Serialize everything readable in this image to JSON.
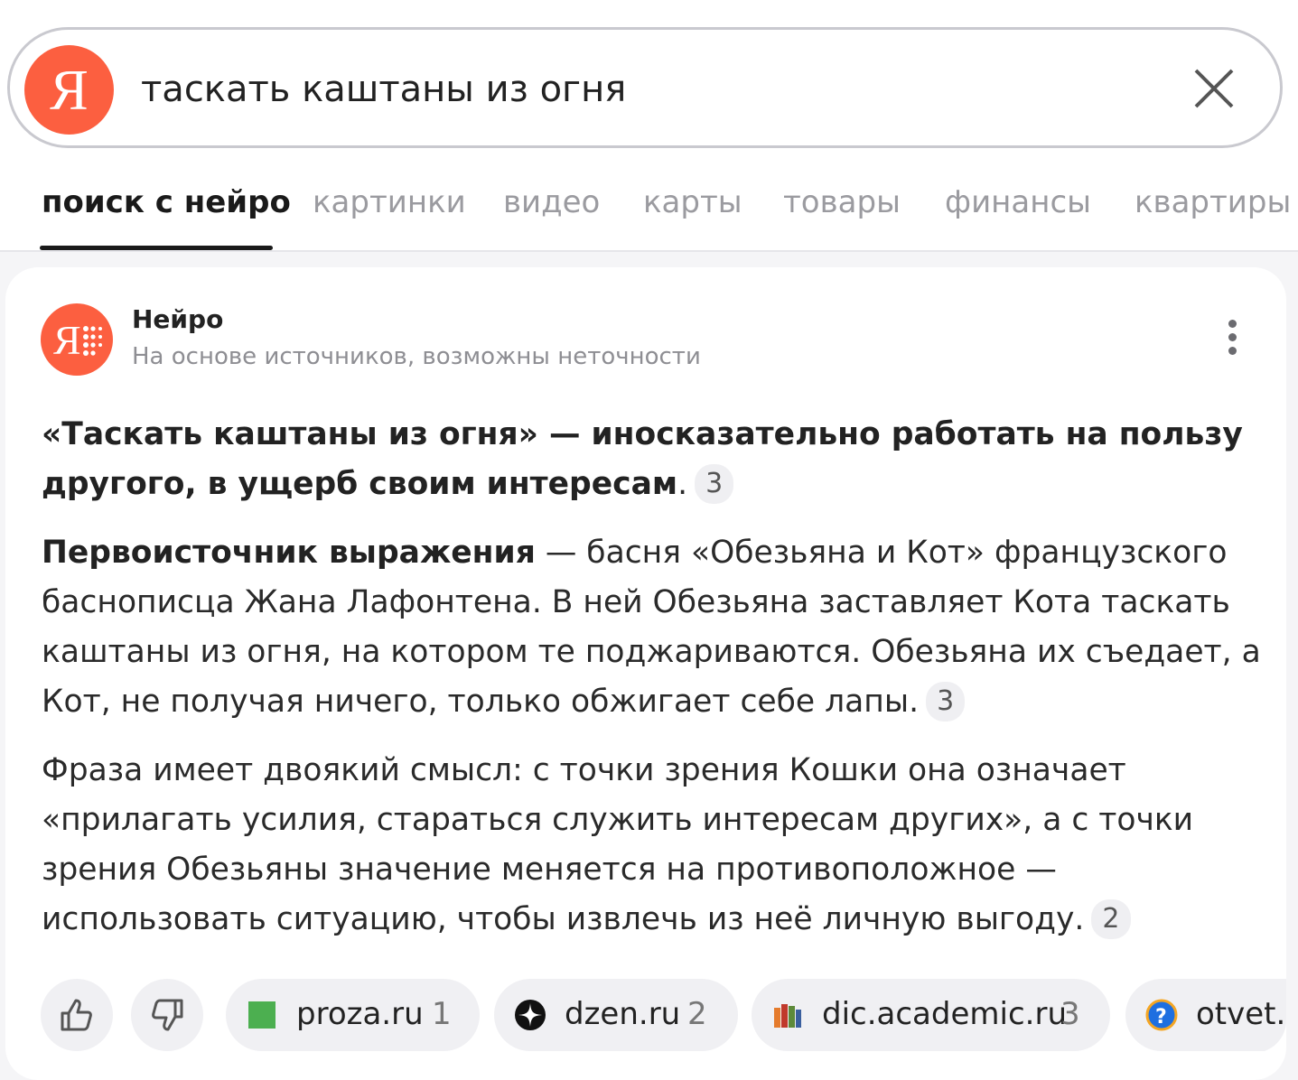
{
  "search": {
    "logo_letter": "Я",
    "query": "таскать каштаны из огня"
  },
  "tabs": [
    {
      "label": "поиск с нейро",
      "active": true
    },
    {
      "label": "картинки"
    },
    {
      "label": "видео"
    },
    {
      "label": "карты"
    },
    {
      "label": "товары"
    },
    {
      "label": "финансы"
    },
    {
      "label": "квартиры"
    }
  ],
  "answer": {
    "source_name": "Нейро",
    "disclaimer": "На основе источников, возможны неточности",
    "p1_bold": "«Таскать каштаны из огня» — иносказательно работать на пользу другого, в ущерб своим интересам",
    "p1_end": ".",
    "p1_cite": "3",
    "p2_bold": "Первоисточник выражения",
    "p2_text": " — басня «Обезьяна и Кот» французского баснописца Жана Лафонтена. В ней Обезьяна заставляет Кота таскать каштаны из огня, на котором те поджариваются. Обезьяна их съедает, а Кот, не получая ничего, только обжигает себе лапы.",
    "p2_cite": "3",
    "p3_text": "Фраза имеет двоякий смысл: с точки зрения Кошки она означает «прилагать усилия, стараться служить интересам других», а с точки зрения Обезьяны значение меняется на противоположное — использовать ситуацию, чтобы извлечь из неё личную выгоду.",
    "p3_cite": "2"
  },
  "sources": [
    {
      "site": "proza.ru",
      "num": "1",
      "icon": "green-square-icon"
    },
    {
      "site": "dzen.ru",
      "num": "2",
      "icon": "dzen-star-icon"
    },
    {
      "site": "dic.academic.ru",
      "num": "3",
      "icon": "books-icon"
    },
    {
      "site": "otvet.mail.ru",
      "num": "",
      "icon": "question-icon"
    }
  ],
  "colors": {
    "accent": "#fc5f40",
    "active_tab": "#1a1a1a",
    "inactive_tab": "#9b9ba0"
  }
}
